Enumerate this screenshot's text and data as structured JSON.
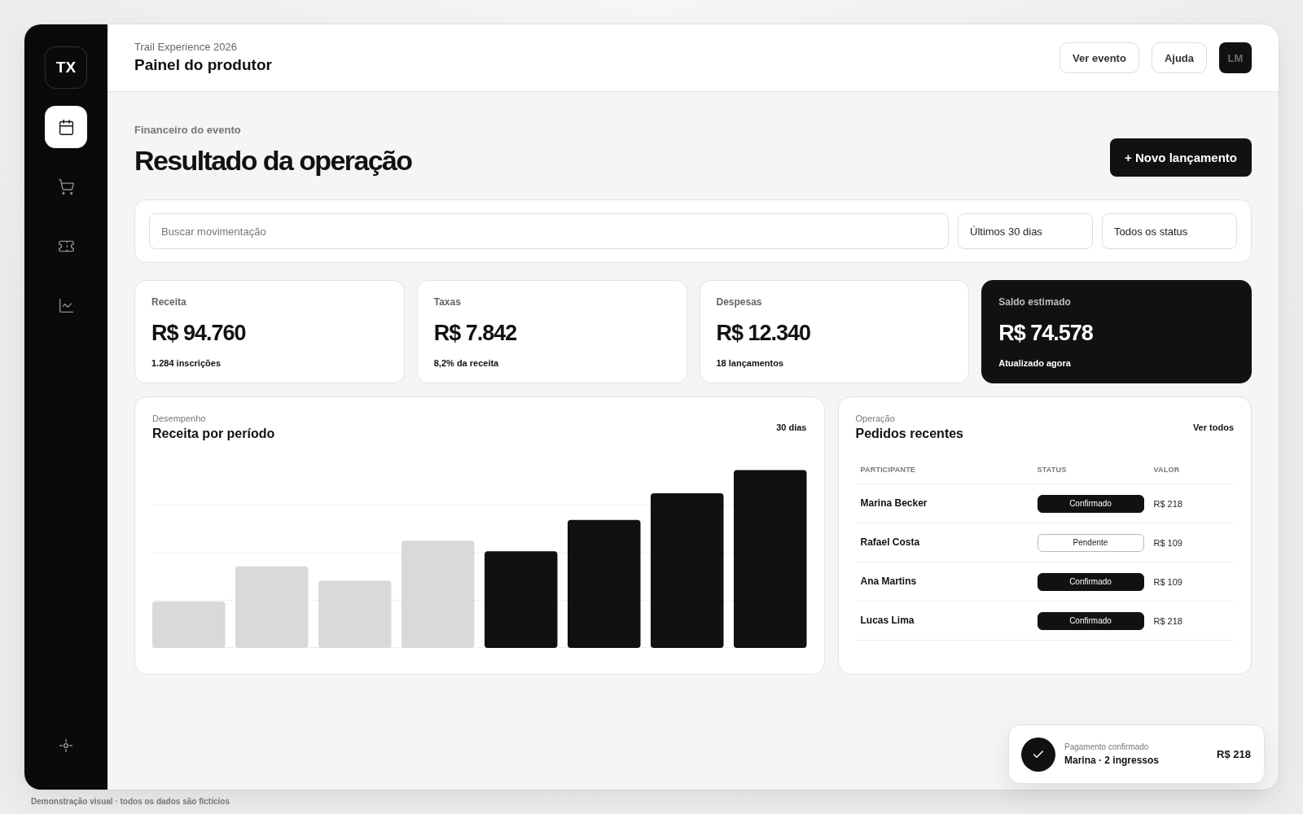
{
  "sidebar": {
    "logo": "TX",
    "items": [
      {
        "selected": true
      },
      {
        "selected": false
      },
      {
        "selected": false
      },
      {
        "selected": false
      }
    ]
  },
  "header": {
    "event": "Trail Experience 2026",
    "title": "Painel do produtor",
    "buttons": [
      "Ver evento",
      "Ajuda"
    ],
    "avatar": "LM"
  },
  "page": {
    "eyebrow": "Financeiro do evento",
    "title": "Resultado da operação",
    "primary_action": "+ Novo lançamento"
  },
  "filters": {
    "search": {
      "placeholder": "Buscar movimentação"
    },
    "selects": [
      {
        "value": "Últimos 30 dias"
      },
      {
        "value": "Todos os status"
      }
    ]
  },
  "stats": [
    {
      "label": "Receita",
      "value": "R$ 94.760",
      "note": "1.284 inscrições",
      "highlighted": false
    },
    {
      "label": "Taxas",
      "value": "R$ 7.842",
      "note": "8,2% da receita",
      "highlighted": false
    },
    {
      "label": "Despesas",
      "value": "R$ 12.340",
      "note": "18 lançamentos",
      "highlighted": false
    },
    {
      "label": "Saldo estimado",
      "value": "R$ 74.578",
      "note": "Atualizado agora",
      "highlighted": true
    }
  ],
  "revenue_chart": {
    "eyebrow": "Desempenho",
    "title": "Receita por período",
    "period": "30 dias"
  },
  "orders": {
    "eyebrow": "Operação",
    "title": "Pedidos recentes",
    "link": "Ver todos",
    "columns": [
      "PARTICIPANTE",
      "STATUS",
      "VALOR"
    ],
    "rows": [
      {
        "participant": "Marina Becker",
        "status": {
          "label": "Confirmado",
          "kind": "confirmed"
        },
        "amount": "R$ 218"
      },
      {
        "participant": "Rafael Costa",
        "status": {
          "label": "Pendente",
          "kind": "pending"
        },
        "amount": "R$ 109"
      },
      {
        "participant": "Ana Martins",
        "status": {
          "label": "Confirmado",
          "kind": "confirmed"
        },
        "amount": "R$ 109"
      },
      {
        "participant": "Lucas Lima",
        "status": {
          "label": "Confirmado",
          "kind": "confirmed"
        },
        "amount": "R$ 218"
      }
    ]
  },
  "toast": {
    "title": "Pagamento confirmado",
    "detail": "Marina · 2 ingressos",
    "amount": "R$ 218"
  },
  "footer_note": "Demonstração visual · todos os dados são fictícios"
}
